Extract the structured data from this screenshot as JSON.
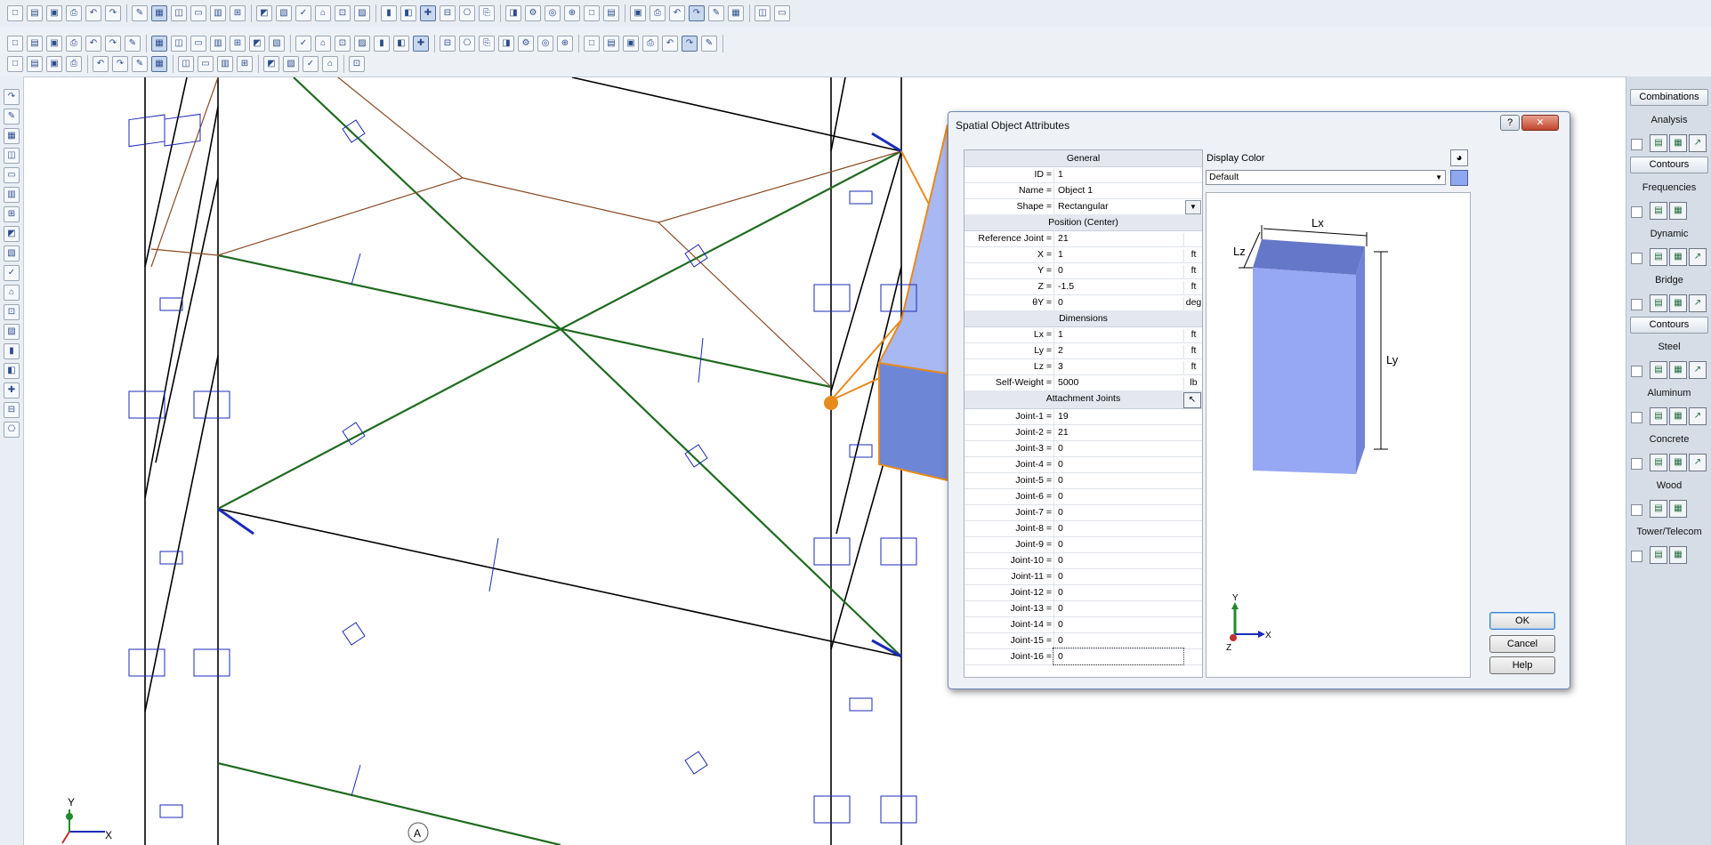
{
  "dialog": {
    "title": "Spatial Object Attributes",
    "help_icon": "?",
    "close_icon": "✕",
    "general": {
      "header": "General",
      "id_label": "ID =",
      "id_value": "1",
      "name_label": "Name =",
      "name_value": "Object 1",
      "shape_label": "Shape =",
      "shape_value": "Rectangular"
    },
    "position": {
      "header": "Position (Center)",
      "rows": [
        {
          "label": "Reference Joint =",
          "value": "21",
          "unit": ""
        },
        {
          "label": "X =",
          "value": "1",
          "unit": "ft"
        },
        {
          "label": "Y =",
          "value": "0",
          "unit": "ft"
        },
        {
          "label": "Z =",
          "value": "-1.5",
          "unit": "ft"
        },
        {
          "label": "θY =",
          "value": "0",
          "unit": "deg"
        }
      ]
    },
    "dimensions": {
      "header": "Dimensions",
      "rows": [
        {
          "label": "Lx =",
          "value": "1",
          "unit": "ft"
        },
        {
          "label": "Ly =",
          "value": "2",
          "unit": "ft"
        },
        {
          "label": "Lz =",
          "value": "3",
          "unit": "ft"
        },
        {
          "label": "Self-Weight =",
          "value": "5000",
          "unit": "lb"
        }
      ]
    },
    "attachment": {
      "header": "Attachment Joints",
      "joints": [
        {
          "label": "Joint-1 =",
          "value": "19"
        },
        {
          "label": "Joint-2 =",
          "value": "21"
        },
        {
          "label": "Joint-3 =",
          "value": "0"
        },
        {
          "label": "Joint-4 =",
          "value": "0"
        },
        {
          "label": "Joint-5 =",
          "value": "0"
        },
        {
          "label": "Joint-6 =",
          "value": "0"
        },
        {
          "label": "Joint-7 =",
          "value": "0"
        },
        {
          "label": "Joint-8 =",
          "value": "0"
        },
        {
          "label": "Joint-9 =",
          "value": "0"
        },
        {
          "label": "Joint-10 =",
          "value": "0"
        },
        {
          "label": "Joint-11 =",
          "value": "0"
        },
        {
          "label": "Joint-12 =",
          "value": "0"
        },
        {
          "label": "Joint-13 =",
          "value": "0"
        },
        {
          "label": "Joint-14 =",
          "value": "0"
        },
        {
          "label": "Joint-15 =",
          "value": "0"
        },
        {
          "label": "Joint-16 =",
          "value": "0"
        }
      ]
    },
    "display_color": {
      "label": "Display Color",
      "selected": "Default",
      "swatch_color": "#8ea7f0"
    },
    "preview": {
      "lx": "Lx",
      "ly": "Ly",
      "lz": "Lz",
      "axis_x": "X",
      "axis_y": "Y",
      "axis_z": "Z",
      "box_color": "#8c9ff0"
    },
    "buttons": {
      "ok": "OK",
      "cancel": "Cancel",
      "help": "Help"
    }
  },
  "right_panel": {
    "combinations": "Combinations",
    "analysis": "Analysis",
    "contours1": "Contours",
    "frequencies": "Frequencies",
    "dynamic": "Dynamic",
    "bridge": "Bridge",
    "contours2": "Contours",
    "steel": "Steel",
    "aluminum": "Aluminum",
    "concrete": "Concrete",
    "wood": "Wood",
    "tower_telecom": "Tower/Telecom"
  },
  "canvas": {
    "axis_x": "X",
    "axis_y": "Y",
    "grid_label": "A",
    "colors": {
      "frame": "#000000",
      "brace": "#1f6b1f",
      "member": "#1b2bb8",
      "selected": "#e88a1e",
      "tie": "#8a4b25"
    }
  }
}
